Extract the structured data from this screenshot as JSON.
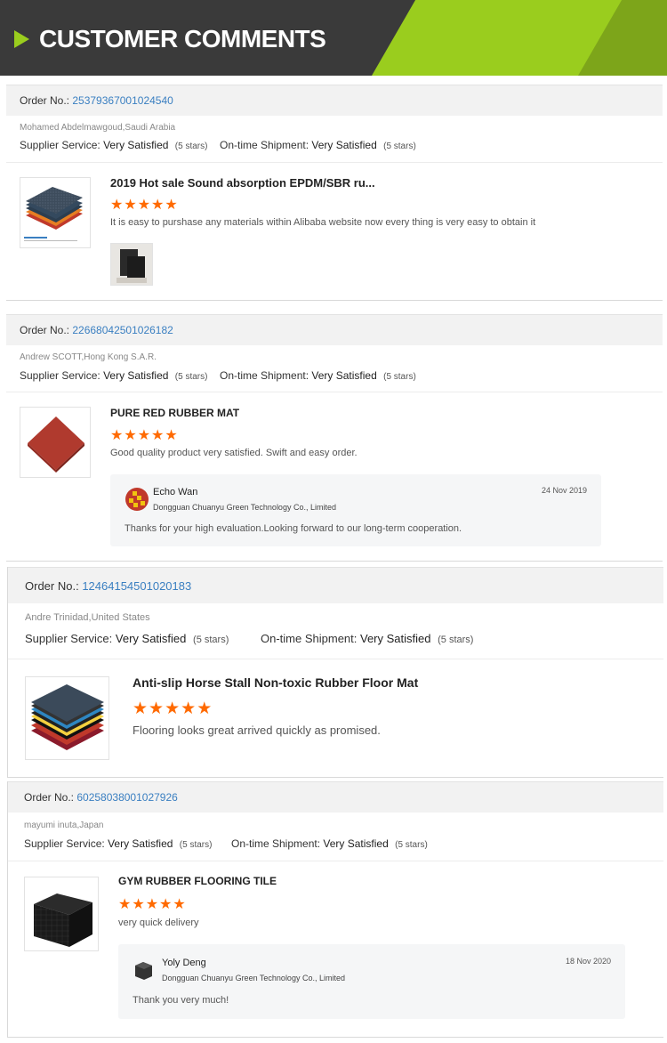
{
  "banner": {
    "title": "CUSTOMER COMMENTS"
  },
  "labels": {
    "order": "Order No.:",
    "supplier_service": "Supplier Service:",
    "ontime_shipment": "On-time Shipment:"
  },
  "colors": {
    "accent_green": "#9acd1e",
    "star_orange": "#ff6a00",
    "link_blue": "#3a7fc1",
    "banner_dark": "#3a3a3a"
  },
  "reviews": [
    {
      "order_no": "25379367001024540",
      "buyer": "Mohamed Abdelmawgoud,Saudi Arabia",
      "supplier_rating": "Very Satisfied",
      "supplier_stars": "(5 stars)",
      "shipment_rating": "Very Satisfied",
      "shipment_stars": "(5 stars)",
      "product": "2019 Hot sale Sound absorption EPDM/SBR ru...",
      "stars": 5,
      "comment": "It is easy to purshase any materials within Alibaba website now every thing is very easy to obtain it"
    },
    {
      "order_no": "22668042501026182",
      "buyer": "Andrew SCOTT,Hong Kong S.A.R.",
      "supplier_rating": "Very Satisfied",
      "supplier_stars": "(5 stars)",
      "shipment_rating": "Very Satisfied",
      "shipment_stars": "(5 stars)",
      "product": "PURE RED RUBBER MAT",
      "stars": 5,
      "comment": "Good quality product very satisfied. Swift and easy order.",
      "reply": {
        "name": "Echo Wan",
        "company": "Dongguan Chuanyu Green Technology Co., Limited",
        "date": "24 Nov 2019",
        "text": "Thanks for your high evaluation.Looking forward to our long-term cooperation."
      }
    },
    {
      "order_no": "12464154501020183",
      "buyer": "Andre Trinidad,United States",
      "supplier_rating": "Very Satisfied",
      "supplier_stars": "(5 stars)",
      "shipment_rating": "Very Satisfied",
      "shipment_stars": "(5 stars)",
      "product": "Anti-slip Horse Stall Non-toxic Rubber Floor Mat",
      "stars": 5,
      "comment": "Flooring looks great arrived quickly as promised."
    },
    {
      "order_no": "60258038001027926",
      "buyer": "mayumi inuta,Japan",
      "supplier_rating": "Very Satisfied",
      "supplier_stars": "(5 stars)",
      "shipment_rating": "Very Satisfied",
      "shipment_stars": "(5 stars)",
      "product": "GYM RUBBER FLOORING TILE",
      "stars": 5,
      "comment": "very quick delivery",
      "reply": {
        "name": "Yoly Deng",
        "company": "Dongguan Chuanyu Green Technology Co., Limited",
        "date": "18 Nov 2020",
        "text": "Thank you very much!"
      }
    }
  ]
}
